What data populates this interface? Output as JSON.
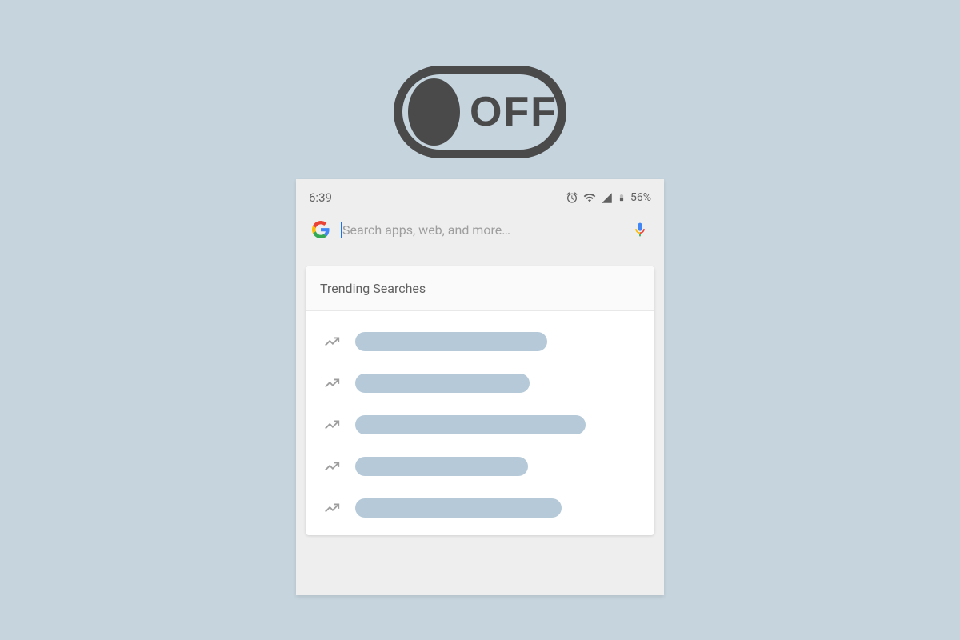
{
  "toggle": {
    "label": "OFF"
  },
  "statusBar": {
    "time": "6:39",
    "battery": "56%"
  },
  "search": {
    "placeholder": "Search apps, web, and more…"
  },
  "trending": {
    "title": "Trending Searches"
  }
}
